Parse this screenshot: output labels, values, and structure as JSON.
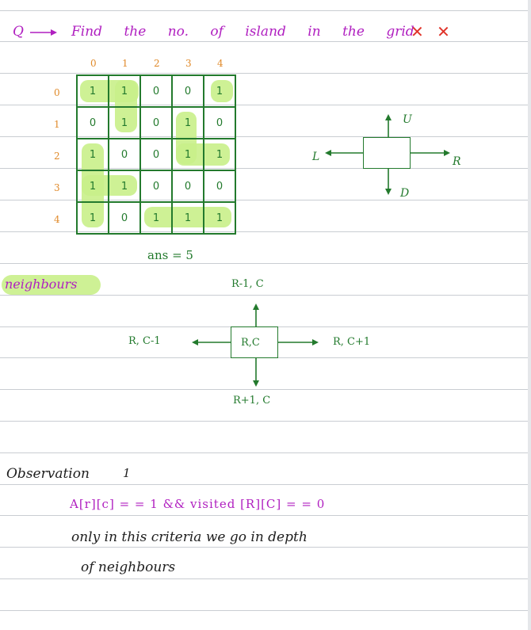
{
  "heading": {
    "label": "Q",
    "text": "Find the no. of island in the grid",
    "marks": "✕ ✕"
  },
  "grid": {
    "col_labels": [
      "0",
      "1",
      "2",
      "3",
      "4"
    ],
    "row_labels": [
      "0",
      "1",
      "2",
      "3",
      "4"
    ],
    "cells": [
      [
        "1",
        "1",
        "0",
        "0",
        "1"
      ],
      [
        "0",
        "1",
        "0",
        "1",
        "0"
      ],
      [
        "1",
        "0",
        "0",
        "1",
        "1"
      ],
      [
        "1",
        "1",
        "0",
        "0",
        "0"
      ],
      [
        "1",
        "0",
        "1",
        "1",
        "1"
      ]
    ],
    "answer": "ans = 5"
  },
  "directions": {
    "up": "U",
    "down": "D",
    "left": "L",
    "right": "R"
  },
  "neighbours": {
    "tag": "neighbours",
    "center": "R,C",
    "top": "R-1, C",
    "bottom": "R+1, C",
    "left": "R, C-1",
    "right": "R, C+1"
  },
  "observation": {
    "title": "Observation",
    "number": "1",
    "condition": "A[r][c] = = 1    &&    visited [R][C] = = 0",
    "line1": "only    in    this    criteria    we    go    in depth",
    "line2": "of    neighbours"
  },
  "colors": {
    "purple": "#b01fc0",
    "green": "#237a2d",
    "highlight": "#c9ef8a",
    "orange": "#e08a2a",
    "red": "#e0342a"
  }
}
